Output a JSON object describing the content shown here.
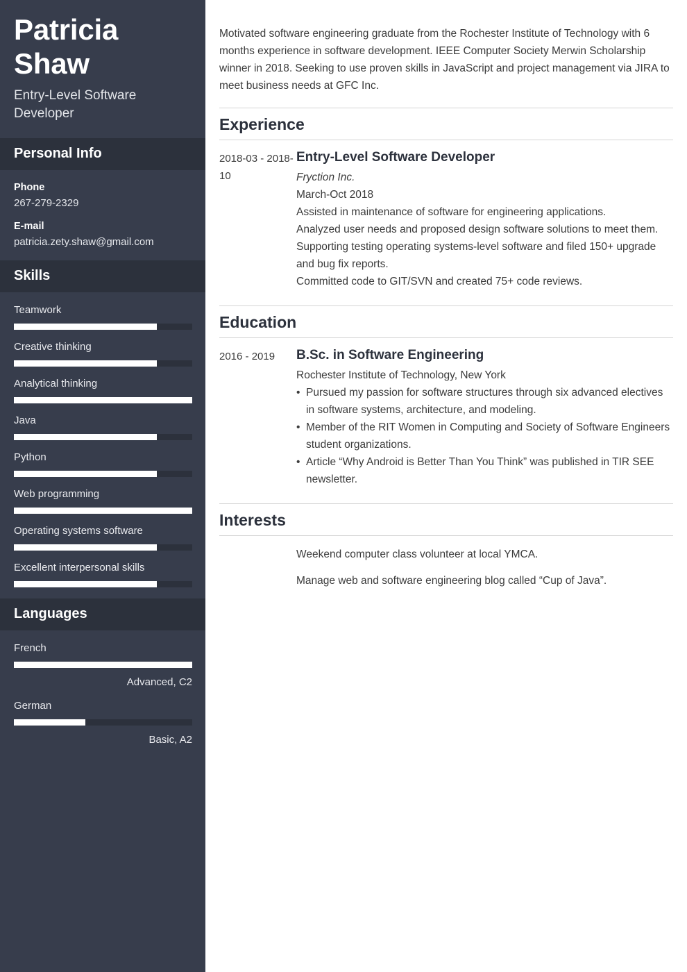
{
  "theme": {
    "sidebar_bg": "#373d4c",
    "sidebar_head_bg": "#2c313c",
    "bar_fill": "#ffffff",
    "bar_track": "#2c313c",
    "text_dark": "#2c313c",
    "text_body": "#3b3b3b",
    "rule": "#d4d4d4",
    "page_bg": "#ffffff"
  },
  "sidebar": {
    "name": "Patricia Shaw",
    "job_title": "Entry-Level Software Developer",
    "personal_info": {
      "heading": "Personal Info",
      "items": [
        {
          "label": "Phone",
          "value": "267-279-2329"
        },
        {
          "label": "E-mail",
          "value": "patricia.zety.shaw@gmail.com"
        }
      ]
    },
    "skills": {
      "heading": "Skills",
      "items": [
        {
          "label": "Teamwork",
          "percent": 80
        },
        {
          "label": "Creative thinking",
          "percent": 80
        },
        {
          "label": "Analytical thinking",
          "percent": 100
        },
        {
          "label": "Java",
          "percent": 80
        },
        {
          "label": "Python",
          "percent": 80
        },
        {
          "label": "Web programming",
          "percent": 100
        },
        {
          "label": "Operating systems software",
          "percent": 80
        },
        {
          "label": "Excellent interpersonal skills",
          "percent": 80
        }
      ]
    },
    "languages": {
      "heading": "Languages",
      "items": [
        {
          "label": "French",
          "percent": 100,
          "level": "Advanced, C2"
        },
        {
          "label": "German",
          "percent": 40,
          "level": "Basic, A2"
        }
      ]
    }
  },
  "main": {
    "summary": "Motivated software engineering graduate from the Rochester Institute of Technology with 6 months experience in software development. IEEE Computer Society Merwin Scholarship winner in 2018. Seeking to use proven skills in JavaScript and project management via JIRA to meet business needs at GFC Inc.",
    "experience": {
      "heading": "Experience",
      "entries": [
        {
          "date": "2018-03 - 2018-10",
          "title": "Entry-Level Software Developer",
          "org": "Fryction Inc.",
          "sub": "March-Oct 2018",
          "lines": [
            "Assisted in maintenance of software for engineering applications.",
            "Analyzed user needs and proposed design software solutions to meet them.",
            "Supporting testing operating systems-level software and filed 150+ upgrade and bug fix reports.",
            "Committed code to GIT/SVN and created 75+ code reviews."
          ]
        }
      ]
    },
    "education": {
      "heading": "Education",
      "entries": [
        {
          "date": "2016 - 2019",
          "title": "B.Sc. in Software Engineering",
          "org": "Rochester Institute of Technology, New York",
          "bullets": [
            "Pursued my passion for software structures through six advanced electives in software systems, architecture, and modeling.",
            "Member of the RIT Women in Computing and Society of Software Engineers student organizations.",
            "Article “Why Android is Better Than You Think” was published in TIR SEE newsletter."
          ]
        }
      ]
    },
    "interests": {
      "heading": "Interests",
      "lines": [
        "Weekend computer class volunteer at local YMCA.",
        "Manage web and software engineering blog called “Cup of Java”."
      ]
    }
  }
}
